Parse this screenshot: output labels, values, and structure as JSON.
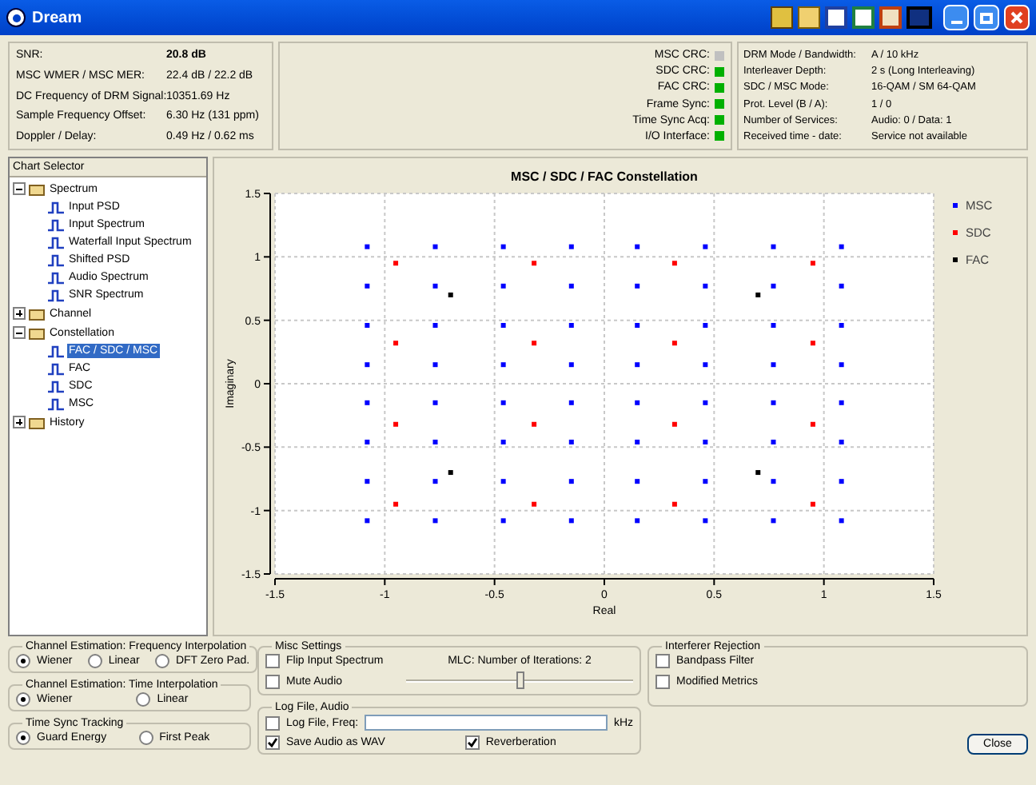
{
  "window": {
    "title": "Dream"
  },
  "signal": [
    {
      "label": "SNR:",
      "value": "20.8 dB",
      "bold": true
    },
    {
      "label": "MSC WMER / MSC MER:",
      "value": "22.4 dB / 22.2 dB",
      "bold": false
    },
    {
      "label": "DC Frequency of DRM Signal:",
      "value": "10351.69 Hz",
      "bold": false
    },
    {
      "label": "Sample Frequency Offset:",
      "value": "6.30 Hz (131 ppm)",
      "bold": false
    },
    {
      "label": "Doppler / Delay:",
      "value": "0.49 Hz / 0.62 ms",
      "bold": false
    }
  ],
  "status": [
    {
      "label": "MSC CRC:",
      "color": "#c0c0c0"
    },
    {
      "label": "SDC CRC:",
      "color": "#00b000"
    },
    {
      "label": "FAC CRC:",
      "color": "#00b000"
    },
    {
      "label": "Frame Sync:",
      "color": "#00b000"
    },
    {
      "label": "Time Sync Acq:",
      "color": "#00b000"
    },
    {
      "label": "I/O Interface:",
      "color": "#00b000"
    }
  ],
  "info": [
    {
      "label": "DRM Mode / Bandwidth:",
      "value": "A / 10 kHz"
    },
    {
      "label": "Interleaver Depth:",
      "value": "2 s (Long Interleaving)"
    },
    {
      "label": "SDC / MSC Mode:",
      "value": "16-QAM / SM 64-QAM"
    },
    {
      "label": "Prot. Level (B / A):",
      "value": "1 / 0"
    },
    {
      "label": "Number of Services:",
      "value": "Audio: 0 / Data: 1"
    },
    {
      "label": "Received time - date:",
      "value": "Service not available"
    }
  ],
  "chart_selector": {
    "title": "Chart Selector",
    "items": [
      {
        "label": "Spectrum",
        "expanded": true,
        "selected": false,
        "children": [
          {
            "label": "Input PSD",
            "selected": false
          },
          {
            "label": "Input Spectrum",
            "selected": false
          },
          {
            "label": "Waterfall Input Spectrum",
            "selected": false
          },
          {
            "label": "Shifted PSD",
            "selected": false
          },
          {
            "label": "Audio Spectrum",
            "selected": false
          },
          {
            "label": "SNR Spectrum",
            "selected": false
          }
        ]
      },
      {
        "label": "Channel",
        "expanded": false,
        "selected": false
      },
      {
        "label": "Constellation",
        "expanded": true,
        "selected": false,
        "children": [
          {
            "label": "FAC / SDC / MSC",
            "selected": true
          },
          {
            "label": "FAC",
            "selected": false
          },
          {
            "label": "SDC",
            "selected": false
          },
          {
            "label": "MSC",
            "selected": false
          }
        ]
      },
      {
        "label": "History",
        "expanded": false,
        "selected": false
      }
    ]
  },
  "chart": {
    "chart_data": {
      "type": "scatter",
      "title": "MSC / SDC / FAC Constellation",
      "xlabel": "Real",
      "grid": true,
      "legend": "right",
      "ylabel": "Imaginary",
      "xlim": [
        -1.5,
        1.5
      ],
      "ylim": [
        -1.5,
        1.5
      ],
      "xticks": [
        -1.5,
        -1,
        -0.5,
        0,
        0.5,
        1,
        1.5
      ],
      "yticks": [
        -1.5,
        -1,
        -0.5,
        0,
        0.5,
        1,
        1.5
      ],
      "series": [
        {
          "name": "MSC",
          "color": "#0000ff",
          "x": [
            -1.08,
            -0.77,
            -0.46,
            -0.15,
            0.15,
            0.46,
            0.77,
            1.08,
            -1.08,
            -0.77,
            -0.46,
            -0.15,
            0.15,
            0.46,
            0.77,
            1.08,
            -1.08,
            -0.77,
            -0.46,
            -0.15,
            0.15,
            0.46,
            0.77,
            1.08,
            -1.08,
            -0.77,
            -0.46,
            -0.15,
            0.15,
            0.46,
            0.77,
            1.08,
            -1.08,
            -0.77,
            -0.46,
            -0.15,
            0.15,
            0.46,
            0.77,
            1.08,
            -1.08,
            -0.77,
            -0.46,
            -0.15,
            0.15,
            0.46,
            0.77,
            1.08,
            -1.08,
            -0.77,
            -0.46,
            -0.15,
            0.15,
            0.46,
            0.77,
            1.08,
            -1.08,
            -0.77,
            -0.46,
            -0.15,
            0.15,
            0.46,
            0.77,
            1.08
          ],
          "values": [
            1.08,
            1.08,
            1.08,
            1.08,
            1.08,
            1.08,
            1.08,
            1.08,
            0.77,
            0.77,
            0.77,
            0.77,
            0.77,
            0.77,
            0.77,
            0.77,
            0.46,
            0.46,
            0.46,
            0.46,
            0.46,
            0.46,
            0.46,
            0.46,
            0.15,
            0.15,
            0.15,
            0.15,
            0.15,
            0.15,
            0.15,
            0.15,
            -0.15,
            -0.15,
            -0.15,
            -0.15,
            -0.15,
            -0.15,
            -0.15,
            -0.15,
            -0.46,
            -0.46,
            -0.46,
            -0.46,
            -0.46,
            -0.46,
            -0.46,
            -0.46,
            -0.77,
            -0.77,
            -0.77,
            -0.77,
            -0.77,
            -0.77,
            -0.77,
            -0.77,
            -1.08,
            -1.08,
            -1.08,
            -1.08,
            -1.08,
            -1.08,
            -1.08,
            -1.08
          ]
        },
        {
          "name": "SDC",
          "color": "#ff0000",
          "x": [
            -0.95,
            -0.32,
            0.32,
            0.95,
            -0.95,
            -0.32,
            0.32,
            0.95,
            -0.95,
            -0.32,
            0.32,
            0.95,
            -0.95,
            -0.32,
            0.32,
            0.95
          ],
          "values": [
            0.95,
            0.95,
            0.95,
            0.95,
            0.32,
            0.32,
            0.32,
            0.32,
            -0.32,
            -0.32,
            -0.32,
            -0.32,
            -0.95,
            -0.95,
            -0.95,
            -0.95
          ]
        },
        {
          "name": "FAC",
          "color": "#000000",
          "x": [
            -0.7,
            0.7,
            -0.7,
            0.7
          ],
          "values": [
            0.7,
            0.7,
            -0.7,
            -0.7
          ]
        }
      ]
    }
  },
  "freq_interp": {
    "title": "Channel Estimation: Frequency Interpolation",
    "options": [
      {
        "label": "Wiener",
        "selected": true
      },
      {
        "label": "Linear",
        "selected": false
      },
      {
        "label": "DFT Zero Pad.",
        "selected": false
      }
    ]
  },
  "time_interp": {
    "title": "Channel Estimation: Time Interpolation",
    "options": [
      {
        "label": "Wiener",
        "selected": true
      },
      {
        "label": "Linear",
        "selected": false
      }
    ]
  },
  "time_sync": {
    "title": "Time Sync Tracking",
    "options": [
      {
        "label": "Guard Energy",
        "selected": true
      },
      {
        "label": "First Peak",
        "selected": false
      }
    ]
  },
  "misc": {
    "title": "Misc Settings",
    "checks": [
      {
        "label": "Flip Input Spectrum",
        "checked": false
      },
      {
        "label": "Mute Audio",
        "checked": false
      }
    ],
    "slider_label": "MLC: Number of Iterations: 2",
    "level": 0.5
  },
  "log": {
    "title": "Log File, Audio",
    "log_label": "Log File, Freq:",
    "log_checked": false,
    "unit": "kHz",
    "checks": [
      {
        "label": "Save Audio as WAV",
        "checked": true
      },
      {
        "label": "Reverberation",
        "checked": true
      }
    ]
  },
  "interferer": {
    "title": "Interferer Rejection",
    "checks": [
      {
        "label": "Bandpass Filter",
        "checked": false
      },
      {
        "label": "Modified Metrics",
        "checked": false
      }
    ]
  },
  "buttons": [
    "Close"
  ]
}
